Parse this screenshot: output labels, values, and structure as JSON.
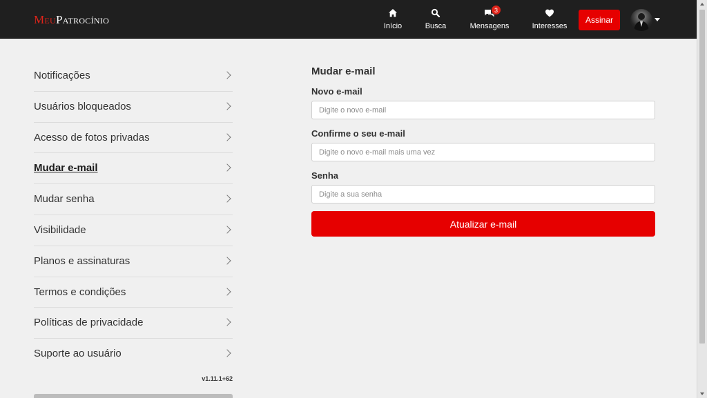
{
  "header": {
    "logo_meu": "Meu",
    "logo_patrocinio": "Patrocínio",
    "nav": [
      {
        "label": "Início",
        "icon": "home-icon"
      },
      {
        "label": "Busca",
        "icon": "search-icon"
      },
      {
        "label": "Mensagens",
        "icon": "chat-icon",
        "badge": "3"
      },
      {
        "label": "Interesses",
        "icon": "heart-icon"
      }
    ],
    "subscribe_label": "Assinar"
  },
  "sidebar": {
    "items": [
      {
        "label": "Notificações"
      },
      {
        "label": "Usuários bloqueados"
      },
      {
        "label": "Acesso de fotos privadas"
      },
      {
        "label": "Mudar e-mail",
        "active": true
      },
      {
        "label": "Mudar senha"
      },
      {
        "label": "Visibilidade"
      },
      {
        "label": "Planos e assinaturas"
      },
      {
        "label": "Termos e condições"
      },
      {
        "label": "Políticas de privacidade"
      },
      {
        "label": "Suporte ao usuário"
      }
    ],
    "version": "v1.11.1+62"
  },
  "form": {
    "title": "Mudar e-mail",
    "new_email": {
      "label": "Novo e-mail",
      "placeholder": "Digite o novo e-mail",
      "value": ""
    },
    "confirm_email": {
      "label": "Confirme o seu e-mail",
      "placeholder": "Digite o novo e-mail mais uma vez",
      "value": ""
    },
    "password": {
      "label": "Senha",
      "placeholder": "Digite a sua senha",
      "value": ""
    },
    "submit_label": "Atualizar e-mail"
  },
  "colors": {
    "accent": "#e60000",
    "topbar": "#1f1f1f",
    "background": "#f0f0f0"
  }
}
